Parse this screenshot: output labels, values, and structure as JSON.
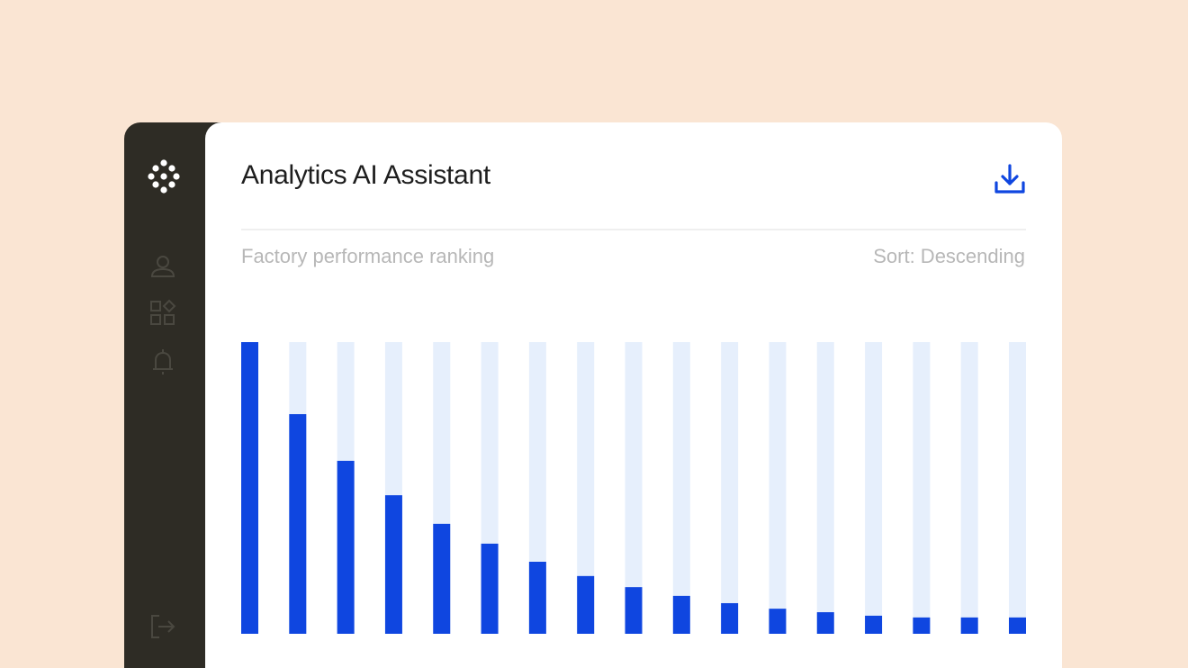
{
  "header": {
    "title": "Analytics AI Assistant",
    "download_icon": "download-icon"
  },
  "sidebar": {
    "logo_icon": "dots-logo-icon",
    "items": [
      {
        "icon": "user-icon"
      },
      {
        "icon": "widgets-icon"
      },
      {
        "icon": "bell-icon"
      }
    ],
    "logout_icon": "logout-icon"
  },
  "toolbar": {
    "subtitle": "Factory performance ranking",
    "sort_label": "Sort: Descending"
  },
  "colors": {
    "background": "#fae5d3",
    "sidebar": "#2e2c25",
    "accent": "#0f46e0",
    "bar_track": "#e6effc",
    "muted_text": "#b7b7b7"
  },
  "chart_data": {
    "type": "bar",
    "title": "Factory performance ranking",
    "sort": "descending",
    "ylim": [
      0,
      100
    ],
    "values": [
      100,
      75.3,
      59.3,
      47.5,
      37.7,
      30.9,
      24.7,
      19.8,
      16.0,
      13.0,
      10.5,
      8.6,
      7.4,
      6.2,
      5.6,
      5.6,
      5.6
    ]
  }
}
